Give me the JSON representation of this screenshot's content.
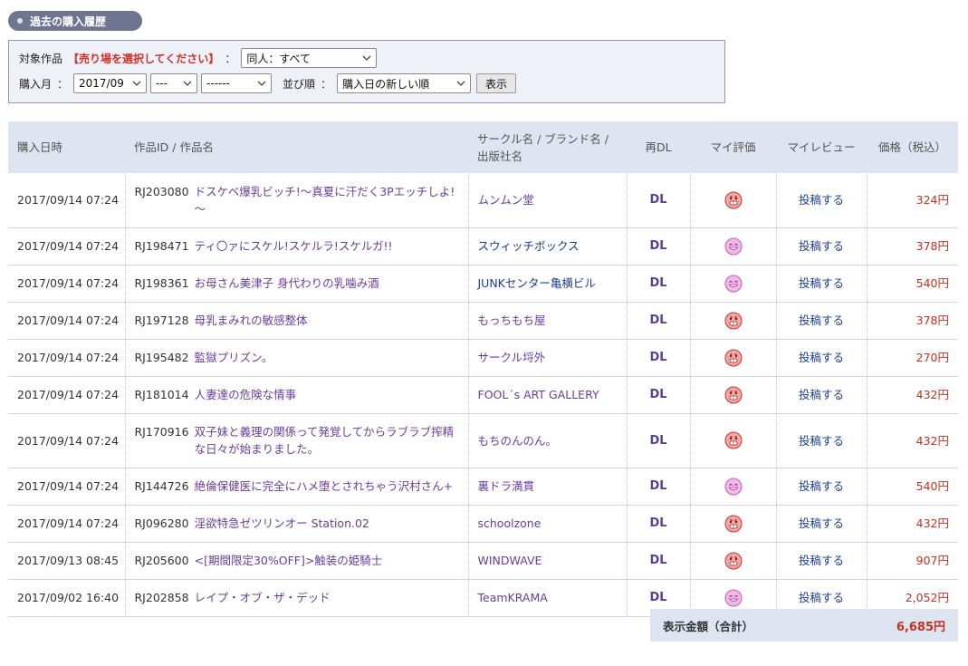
{
  "page_title": "過去の購入履歴",
  "filter": {
    "target_label": "対象作品",
    "target_warning": "【売り場を選択してください】",
    "colon": "：",
    "target_value": "同人：すべて",
    "month_label": "購入月",
    "month_value": "2017/09",
    "day_value": "---",
    "extra_value": "------",
    "sort_label": "並び順",
    "sort_value": "購入日の新しい順",
    "show_button": "表示"
  },
  "table": {
    "headers": {
      "date": "購入日時",
      "work": "作品ID / 作品名",
      "circle_line1": "サークル名 / ブランド名 /",
      "circle_line2": "出版社名",
      "redl": "再DL",
      "rating": "マイ評価",
      "review": "マイレビュー",
      "price": "価格（税込）"
    },
    "rows": [
      {
        "date": "2017/09/14 07:24",
        "id": "RJ203080",
        "name": "ドスケベ爆乳ビッチ!～真夏に汗だく3Pエッチしよ!～",
        "circle": "ムンムン堂",
        "dl": "DL",
        "rating": "angry",
        "review": "投稿する",
        "price": "324円"
      },
      {
        "date": "2017/09/14 07:24",
        "id": "RJ198471",
        "name": "ティ〇ァにスケル!スケルラ!スケルガ!!",
        "circle": "スウィッチボックス",
        "dl": "DL",
        "rating": "happy",
        "review": "投稿する",
        "price": "378円"
      },
      {
        "date": "2017/09/14 07:24",
        "id": "RJ198361",
        "name": "お母さん美津子 身代わりの乳噛み酒",
        "circle": "JUNKセンター亀横ビル",
        "dl": "DL",
        "rating": "happy",
        "review": "投稿する",
        "price": "540円"
      },
      {
        "date": "2017/09/14 07:24",
        "id": "RJ197128",
        "name": "母乳まみれの敏感整体",
        "circle": "もっちもち屋",
        "dl": "DL",
        "rating": "angry",
        "review": "投稿する",
        "price": "378円"
      },
      {
        "date": "2017/09/14 07:24",
        "id": "RJ195482",
        "name": "監獄プリズン。",
        "circle": "サークル埒外",
        "dl": "DL",
        "rating": "angry",
        "review": "投稿する",
        "price": "270円"
      },
      {
        "date": "2017/09/14 07:24",
        "id": "RJ181014",
        "name": "人妻達の危険な情事",
        "circle": "FOOL´s ART GALLERY",
        "dl": "DL",
        "rating": "angry",
        "review": "投稿する",
        "price": "432円"
      },
      {
        "date": "2017/09/14 07:24",
        "id": "RJ170916",
        "name": "双子妹と義理の関係って発覚してからラブラブ搾精な日々が始まりました。",
        "circle": "もちのんのん。",
        "dl": "DL",
        "rating": "angry",
        "review": "投稿する",
        "price": "432円"
      },
      {
        "date": "2017/09/14 07:24",
        "id": "RJ144726",
        "name": "絶倫保健医に完全にハメ堕とされちゃう沢村さん+",
        "circle": "裏ドラ満貫",
        "dl": "DL",
        "rating": "happy",
        "review": "投稿する",
        "price": "540円"
      },
      {
        "date": "2017/09/14 07:24",
        "id": "RJ096280",
        "name": "淫欲特急ゼツリンオー Station.02",
        "circle": "schoolzone",
        "dl": "DL",
        "rating": "angry",
        "review": "投稿する",
        "price": "432円"
      },
      {
        "date": "2017/09/13 08:45",
        "id": "RJ205600",
        "name": "<[期間限定30%OFF]>触装の姫騎士",
        "circle": "WINDWAVE",
        "dl": "DL",
        "rating": "angry",
        "review": "投稿する",
        "price": "907円"
      },
      {
        "date": "2017/09/02 16:40",
        "id": "RJ202858",
        "name": "レイプ・オブ・ザ・デッド",
        "circle": "TeamKRAMA",
        "dl": "DL",
        "rating": "happy",
        "review": "投稿する",
        "price": "2,052円"
      }
    ]
  },
  "total": {
    "label": "表示金額（合計）",
    "value": "6,685円"
  },
  "colors": {
    "accent_title": "#6f7490",
    "link_purple": "#6a3d9a",
    "link_navy": "#1a3f8f",
    "price_red": "#c0311f",
    "header_bg": "#dfe5f0"
  }
}
